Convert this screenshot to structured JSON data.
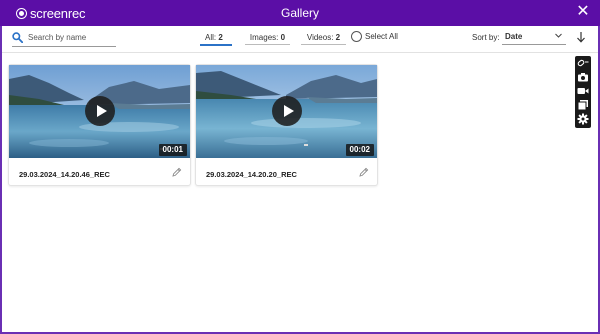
{
  "window": {
    "logo_text": "screenrec",
    "title": "Gallery",
    "close_glyph": "✕"
  },
  "toolbar": {
    "search_placeholder": "Search by name",
    "filters": [
      {
        "label": "All:",
        "count": "2",
        "active": true
      },
      {
        "label": "Images:",
        "count": "0",
        "active": false
      },
      {
        "label": "Videos:",
        "count": "2",
        "active": false
      }
    ],
    "select_all_label": "Select All",
    "sort_by_label": "Sort by:",
    "sort_value": "Date"
  },
  "items": [
    {
      "name": "29.03.2024_14.20.46_REC",
      "duration": "00:01"
    },
    {
      "name": "29.03.2024_14.20.20_REC",
      "duration": "00:02"
    }
  ],
  "sidebar": {
    "icons": [
      "link-icon",
      "camera-icon",
      "video-camera-icon",
      "gallery-icon",
      "settings-icon"
    ]
  },
  "colors": {
    "titlebar": "#5b0ea6",
    "accent": "#2b72c7",
    "sidebar": "#1a1a1a"
  }
}
